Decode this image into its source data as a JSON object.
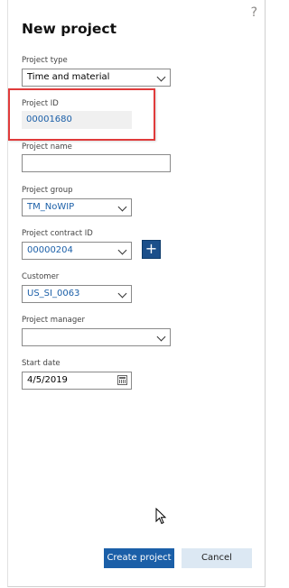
{
  "dialog": {
    "title": "New project",
    "help_icon": "?"
  },
  "fields": {
    "project_type": {
      "label": "Project type",
      "value": "Time and material"
    },
    "project_id": {
      "label": "Project ID",
      "value": "00001680"
    },
    "project_name": {
      "label": "Project name",
      "value": ""
    },
    "project_group": {
      "label": "Project group",
      "value": "TM_NoWIP"
    },
    "project_contract_id": {
      "label": "Project contract ID",
      "value": "00000204"
    },
    "customer": {
      "label": "Customer",
      "value": "US_SI_0063"
    },
    "project_manager": {
      "label": "Project manager",
      "value": ""
    },
    "start_date": {
      "label": "Start date",
      "value": "4/5/2019"
    }
  },
  "buttons": {
    "add_contract": "+",
    "create": "Create project",
    "cancel": "Cancel"
  },
  "colors": {
    "primary": "#1b5fa8",
    "highlight": "#e03b3b",
    "add_button": "#1b4f8a"
  }
}
